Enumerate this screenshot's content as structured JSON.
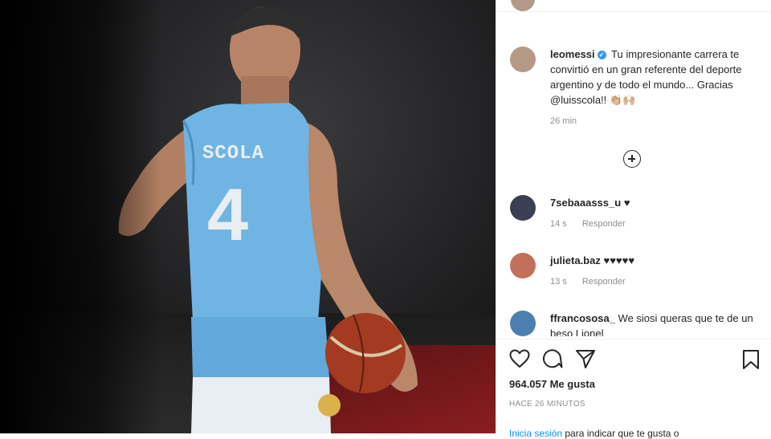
{
  "post": {
    "player_name": "SCOLA",
    "player_number": "4"
  },
  "caption": {
    "username": "leomessi",
    "verified_mark": "✔",
    "text": "Tu impresionante carrera te convirtió en un gran referente del deporte argentino y de todo el mundo... Gracias @luisscola!! ",
    "emoji": "👏🏼🙌🏼",
    "time": "26 min"
  },
  "comments": [
    {
      "username": "7sebaaasss_u",
      "text": "♥",
      "time": "14 s",
      "reply": "Responder",
      "avatar_color": "#3b3f55"
    },
    {
      "username": "julieta.baz",
      "text": "♥♥♥♥♥",
      "time": "13 s",
      "reply": "Responder",
      "avatar_color": "#c2705a"
    },
    {
      "username": "ffrancososa_",
      "text": "We siosi queras que te de un beso Lionel",
      "time": "",
      "reply": "",
      "avatar_color": "#4b7fb0"
    }
  ],
  "actions": {
    "likes": "964.057 Me gusta",
    "time": "HACE 26 MINUTOS"
  },
  "login_prompt": {
    "link": "Inicia sesión",
    "text": " para indicar que te gusta o"
  },
  "colors": {
    "jersey": "#6fb4e3",
    "link": "#0095f6",
    "verified": "#3897f0"
  }
}
